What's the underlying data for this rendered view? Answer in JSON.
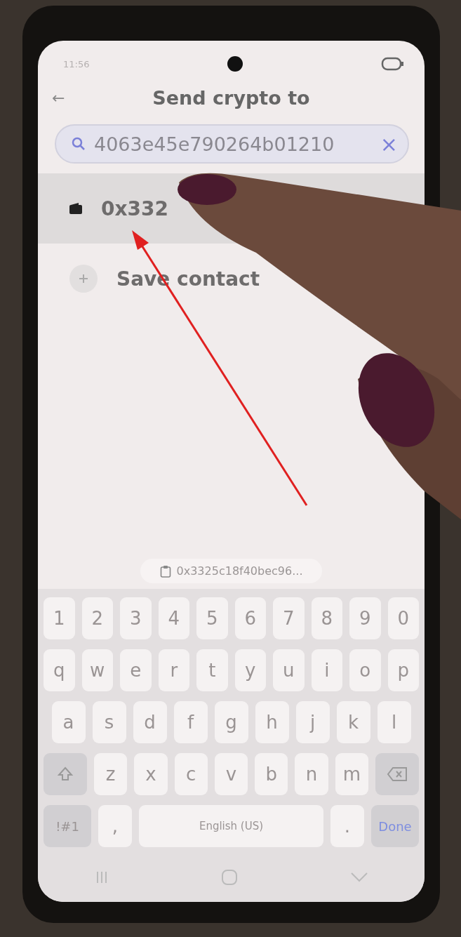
{
  "status_bar": {
    "time": "11:56"
  },
  "header": {
    "back": "←",
    "title": "Send crypto to"
  },
  "search": {
    "value": "4063e45e790264b01210",
    "clear": "×"
  },
  "results": [
    {
      "kind": "wallet",
      "label": "0x332",
      "selected": true
    },
    {
      "kind": "add",
      "label": "Save contact",
      "selected": false
    }
  ],
  "clipboard_suggestion": "0x3325c18f40bec96...",
  "keyboard": {
    "number_keys": [
      {
        "kind": "char",
        "label": "1"
      },
      {
        "kind": "char",
        "label": "2"
      },
      {
        "kind": "char",
        "label": "3"
      },
      {
        "kind": "char",
        "label": "4"
      },
      {
        "kind": "char",
        "label": "5"
      },
      {
        "kind": "char",
        "label": "6"
      },
      {
        "kind": "char",
        "label": "7"
      },
      {
        "kind": "char",
        "label": "8"
      },
      {
        "kind": "char",
        "label": "9"
      },
      {
        "kind": "char",
        "label": "0"
      }
    ],
    "top_letter_keys": [
      {
        "kind": "char",
        "label": "q"
      },
      {
        "kind": "char",
        "label": "w"
      },
      {
        "kind": "char",
        "label": "e"
      },
      {
        "kind": "char",
        "label": "r"
      },
      {
        "kind": "char",
        "label": "t"
      },
      {
        "kind": "char",
        "label": "y"
      },
      {
        "kind": "char",
        "label": "u"
      },
      {
        "kind": "char",
        "label": "i"
      },
      {
        "kind": "char",
        "label": "o"
      },
      {
        "kind": "char",
        "label": "p"
      }
    ],
    "middle_letter_keys": [
      {
        "kind": "char",
        "label": "a"
      },
      {
        "kind": "char",
        "label": "s"
      },
      {
        "kind": "char",
        "label": "d"
      },
      {
        "kind": "char",
        "label": "f"
      },
      {
        "kind": "char",
        "label": "g"
      },
      {
        "kind": "char",
        "label": "h"
      },
      {
        "kind": "char",
        "label": "j"
      },
      {
        "kind": "char",
        "label": "k"
      },
      {
        "kind": "char",
        "label": "l"
      }
    ],
    "bottom_letter_keys": [
      {
        "kind": "shift"
      },
      {
        "kind": "char",
        "label": "z"
      },
      {
        "kind": "char",
        "label": "x"
      },
      {
        "kind": "char",
        "label": "c"
      },
      {
        "kind": "char",
        "label": "v"
      },
      {
        "kind": "char",
        "label": "b"
      },
      {
        "kind": "char",
        "label": "n"
      },
      {
        "kind": "char",
        "label": "m"
      },
      {
        "kind": "backspace"
      }
    ],
    "function_keys": [
      {
        "kind": "symbols",
        "label": "!#1"
      },
      {
        "kind": "char",
        "label": ","
      },
      {
        "kind": "space",
        "label": "English (US)"
      },
      {
        "kind": "char",
        "label": "."
      },
      {
        "kind": "done",
        "label": "Done"
      }
    ]
  }
}
